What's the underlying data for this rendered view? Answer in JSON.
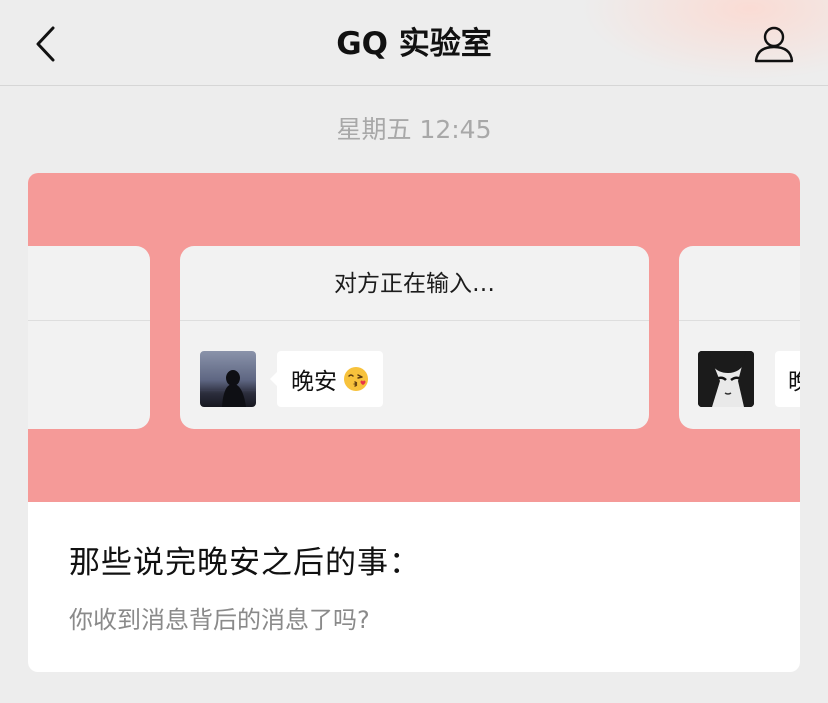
{
  "header": {
    "title": "GQ 实验室",
    "back_icon": "chevron-left-icon",
    "profile_icon": "person-icon"
  },
  "chat": {
    "timestamp": "星期五 12:45"
  },
  "article": {
    "title": "那些说完晚安之后的事：",
    "description": "你收到消息背后的消息了吗?",
    "cover": {
      "background_color": "#f59a98",
      "typing_status": "对方正在输入…",
      "center_message": "晚安",
      "center_emoji": "kissing-face-icon",
      "right_message_partial": "晚"
    }
  },
  "colors": {
    "nav_background": "#ededed",
    "cover_pink": "#f59a98",
    "timestamp_gray": "#a8a8a8",
    "description_gray": "#8a8a8a"
  }
}
